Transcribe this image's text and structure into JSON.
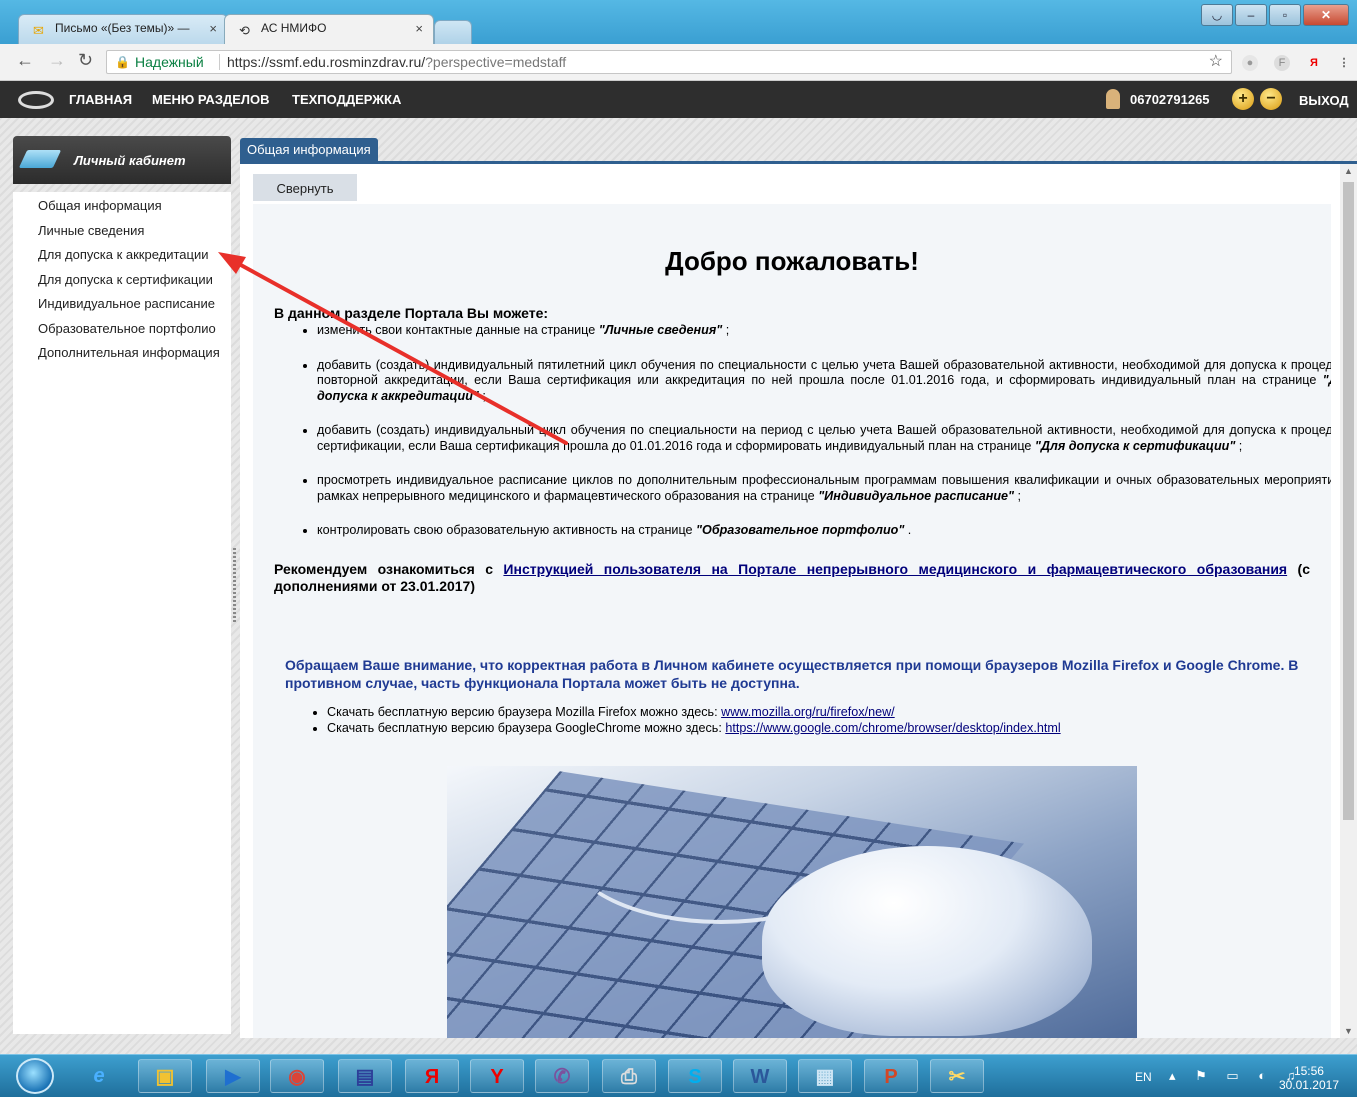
{
  "browser": {
    "tabs": [
      {
        "title": "Письмо «(Без темы)» —",
        "close": "×",
        "active": false
      },
      {
        "title": "АС НМИФО",
        "close": "×",
        "active": true
      }
    ],
    "secure_label": "Надежный",
    "url_host": "https://ssmf.edu.rosminzdrav.ru/",
    "url_path": "?perspective=medstaff"
  },
  "site_header": {
    "nav": [
      "ГЛАВНАЯ",
      "МЕНЮ РАЗДЕЛОВ",
      "ТЕХПОДДЕРЖКА"
    ],
    "user_id": "06702791265",
    "exit_label": "ВЫХОД"
  },
  "sidebar": {
    "title": "Личный кабинет",
    "items": [
      "Общая информация",
      "Личные сведения",
      "Для допуска к аккредитации",
      "Для допуска к сертификации",
      "Индивидуальное расписание",
      "Образовательное портфолио",
      "Дополнительная информация"
    ]
  },
  "main": {
    "tab_title": "Общая информация",
    "collapse_label": "Свернуть",
    "welcome": "Добро пожаловать!",
    "lead": "В данном разделе Портала Вы можете:",
    "bullets": [
      {
        "text": "изменить свои контактные данные на странице ",
        "page": "\"Личные сведения\"",
        "tail": " ;"
      },
      {
        "text": "добавить (создать) индивидуальный пятилетний цикл обучения по специальности с целью учета Вашей образовательной активности, необходимой для допуска к процедуре повторной аккредитации, если Ваша сертификация или аккредитация по ней прошла после 01.01.2016 года, и сформировать индивидуальный план на странице ",
        "page": "\"Для допуска к аккредитации\"",
        "tail": " ;"
      },
      {
        "text": "добавить (создать) индивидуальный цикл обучения по специальности на период с целью учета Вашей образовательной активности, необходимой для допуска к процедуре сертификации, если Ваша сертификация прошла до 01.01.2016 года и сформировать индивидуальный план на странице ",
        "page": "\"Для допуска к сертификации\"",
        "tail": " ;"
      },
      {
        "text": "просмотреть индивидуальное расписание циклов по дополнительным профессиональным программам повышения квалификации и очных образовательных мероприятий в рамках непрерывного медицинского и фармацевтического образования на странице ",
        "page": "\"Индивидуальное расписание\"",
        "tail": " ;"
      },
      {
        "text": "контролировать свою образовательную активность на странице ",
        "page": "\"Образовательное портфолио\"",
        "tail": " ."
      }
    ],
    "recommend_prefix": "Рекомендуем ознакомиться с ",
    "recommend_link": "Инструкцией пользователя на Портале непрерывного медицинского и фармацевтического образования",
    "recommend_suffix": " (с дополнениями от 23.01.2017)",
    "attention": "Обращаем Ваше внимание, что корректная работа в Личном кабинете осуществляется при помощи браузеров Mozilla Firefox и Google Chrome. В противном случае, часть функционала Портала может быть не доступна.",
    "downloads": [
      {
        "text": "Скачать бесплатную версию браузера Mozilla Firefox можно здесь: ",
        "link": "www.mozilla.org/ru/firefox/new/"
      },
      {
        "text": "Скачать бесплатную версию браузера GoogleChrome можно здесь: ",
        "link": "https://www.google.com/chrome/browser/desktop/index.html"
      }
    ]
  },
  "taskbar": {
    "apps": [
      "ie-icon",
      "explorer-icon",
      "media-icon",
      "chrome-icon",
      "save-icon",
      "yandex-icon",
      "yandex-browser-icon",
      "viber-icon",
      "printer-icon",
      "skype-icon",
      "word-icon",
      "picture-icon",
      "powerpoint-icon",
      "snipping-icon"
    ],
    "language": "EN",
    "time": "15:56",
    "date": "30.01.2017"
  },
  "colors": {
    "header_bg": "#2e2e2e",
    "tab_blue": "#2f5f8f",
    "attention_text": "#1f3a93",
    "link": "#00007a",
    "annotation_arrow": "#e8302a"
  }
}
